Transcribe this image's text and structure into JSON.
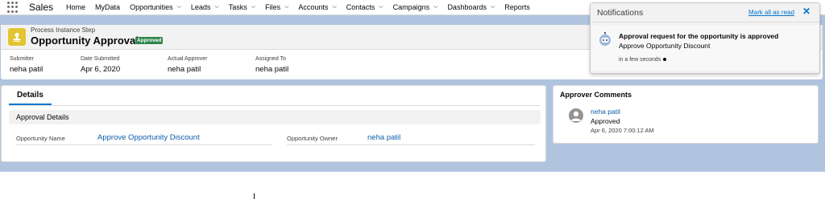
{
  "app": {
    "name": "Sales",
    "icon": "app-launcher-waffle-icon"
  },
  "nav": [
    {
      "label": "Home",
      "chevron": false
    },
    {
      "label": "MyData",
      "chevron": false
    },
    {
      "label": "Opportunities",
      "chevron": true
    },
    {
      "label": "Leads",
      "chevron": true
    },
    {
      "label": "Tasks",
      "chevron": true
    },
    {
      "label": "Files",
      "chevron": true
    },
    {
      "label": "Accounts",
      "chevron": true
    },
    {
      "label": "Contacts",
      "chevron": true
    },
    {
      "label": "Campaigns",
      "chevron": true
    },
    {
      "label": "Dashboards",
      "chevron": true
    },
    {
      "label": "Reports",
      "chevron": false
    }
  ],
  "record": {
    "object_label": "Process Instance Step",
    "title": "Opportunity Approval",
    "status_badge": "Approved",
    "icon": "approval-icon",
    "fields": {
      "submitter": {
        "label": "Submitter",
        "value": "neha patil"
      },
      "date_submitted": {
        "label": "Date Submitted",
        "value": "Apr 6, 2020"
      },
      "actual_approver": {
        "label": "Actual Approver",
        "value": "neha patil"
      },
      "assigned_to": {
        "label": "Assigned To",
        "value": "neha patil"
      }
    }
  },
  "details": {
    "tab_label": "Details",
    "section_label": "Approval Details",
    "opportunity_name": {
      "label": "Opportunity Name",
      "value": "Approve Opportunity Discount"
    },
    "opportunity_owner": {
      "label": "Opportunity Owner",
      "value": "neha patil"
    }
  },
  "approver_comments": {
    "title": "Approver Comments",
    "name": "neha patil",
    "status": "Approved",
    "date": "Apr 6, 2020 7:00:12 AM"
  },
  "notifications": {
    "title": "Notifications",
    "mark_all_read": "Mark all as read",
    "close_glyph": "✕",
    "item": {
      "title": "Approval request for the opportunity is approved",
      "body": "Approve Opportunity Discount",
      "time": "in a few seconds"
    }
  },
  "colors": {
    "brand_blue": "#0176d3",
    "link_blue": "#0b5cab",
    "badge_green": "#2e844a",
    "icon_yellow": "#e3c431",
    "page_background": "#b0c4df"
  }
}
